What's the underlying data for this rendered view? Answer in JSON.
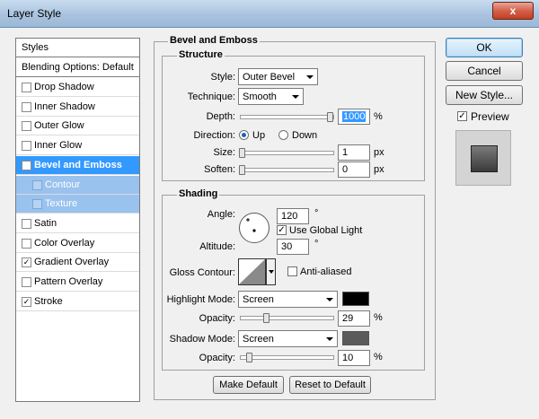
{
  "window": {
    "title": "Layer Style",
    "close": "x"
  },
  "list": {
    "header": "Styles",
    "blending": "Blending Options: Default",
    "items": [
      {
        "label": "Drop Shadow",
        "checked": false
      },
      {
        "label": "Inner Shadow",
        "checked": false
      },
      {
        "label": "Outer Glow",
        "checked": false
      },
      {
        "label": "Inner Glow",
        "checked": false
      },
      {
        "label": "Bevel and Emboss",
        "checked": true
      },
      {
        "label": "Contour",
        "checked": false
      },
      {
        "label": "Texture",
        "checked": false
      },
      {
        "label": "Satin",
        "checked": false
      },
      {
        "label": "Color Overlay",
        "checked": false
      },
      {
        "label": "Gradient Overlay",
        "checked": true
      },
      {
        "label": "Pattern Overlay",
        "checked": false
      },
      {
        "label": "Stroke",
        "checked": true
      }
    ],
    "check_mark": "✓"
  },
  "bevel": {
    "title": "Bevel and Emboss",
    "structure": {
      "title": "Structure",
      "style_label": "Style:",
      "style_value": "Outer Bevel",
      "technique_label": "Technique:",
      "technique_value": "Smooth",
      "depth_label": "Depth:",
      "depth_value": "1000",
      "depth_unit": "%",
      "direction_label": "Direction:",
      "up_label": "Up",
      "down_label": "Down",
      "size_label": "Size:",
      "size_value": "1",
      "size_unit": "px",
      "soften_label": "Soften:",
      "soften_value": "0",
      "soften_unit": "px"
    },
    "shading": {
      "title": "Shading",
      "angle_label": "Angle:",
      "angle_value": "120",
      "angle_unit": "°",
      "global_light_label": "Use Global Light",
      "altitude_label": "Altitude:",
      "altitude_value": "30",
      "altitude_unit": "°",
      "gloss_label": "Gloss Contour:",
      "anti_aliased_label": "Anti-aliased",
      "highlight_label": "Highlight Mode:",
      "highlight_value": "Screen",
      "highlight_color": "#000000",
      "opacity1_label": "Opacity:",
      "opacity1_value": "29",
      "opacity1_unit": "%",
      "shadow_label": "Shadow Mode:",
      "shadow_value": "Screen",
      "shadow_color": "#5a5a5a",
      "opacity2_label": "Opacity:",
      "opacity2_value": "10",
      "opacity2_unit": "%"
    },
    "make_default": "Make Default",
    "reset_default": "Reset to Default"
  },
  "buttons": {
    "ok": "OK",
    "cancel": "Cancel",
    "new_style": "New Style...",
    "preview": "Preview"
  }
}
